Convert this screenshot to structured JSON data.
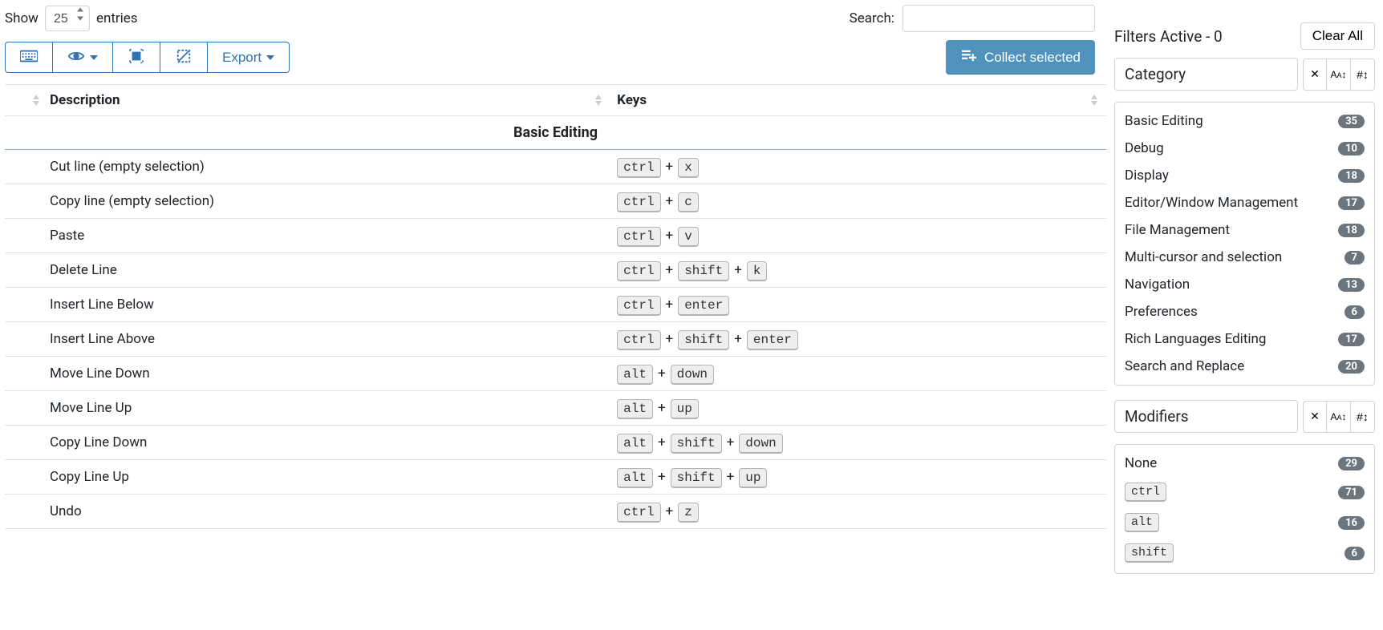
{
  "top": {
    "show_label_pre": "Show",
    "show_value": "25",
    "show_label_post": "entries",
    "search_label": "Search:",
    "search_value": ""
  },
  "toolbar": {
    "export_label": "Export",
    "collect_label": "Collect selected"
  },
  "table": {
    "col_description": "Description",
    "col_keys": "Keys",
    "group_label": "Basic Editing",
    "rows": [
      {
        "desc": "Cut line (empty selection)",
        "keys": [
          "ctrl",
          "x"
        ]
      },
      {
        "desc": "Copy line (empty selection)",
        "keys": [
          "ctrl",
          "c"
        ]
      },
      {
        "desc": "Paste",
        "keys": [
          "ctrl",
          "v"
        ]
      },
      {
        "desc": "Delete Line",
        "keys": [
          "ctrl",
          "shift",
          "k"
        ]
      },
      {
        "desc": "Insert Line Below",
        "keys": [
          "ctrl",
          "enter"
        ]
      },
      {
        "desc": "Insert Line Above",
        "keys": [
          "ctrl",
          "shift",
          "enter"
        ]
      },
      {
        "desc": "Move Line Down",
        "keys": [
          "alt",
          "down"
        ]
      },
      {
        "desc": "Move Line Up",
        "keys": [
          "alt",
          "up"
        ]
      },
      {
        "desc": "Copy Line Down",
        "keys": [
          "alt",
          "shift",
          "down"
        ]
      },
      {
        "desc": "Copy Line Up",
        "keys": [
          "alt",
          "shift",
          "up"
        ]
      },
      {
        "desc": "Undo",
        "keys": [
          "ctrl",
          "z"
        ]
      }
    ]
  },
  "sidebar": {
    "filters_label": "Filters Active - 0",
    "clear_label": "Clear All",
    "category_title": "Category",
    "modifiers_title": "Modifiers",
    "categories": [
      {
        "name": "Basic Editing",
        "count": "35"
      },
      {
        "name": "Debug",
        "count": "10"
      },
      {
        "name": "Display",
        "count": "18"
      },
      {
        "name": "Editor/Window Management",
        "count": "17"
      },
      {
        "name": "File Management",
        "count": "18"
      },
      {
        "name": "Multi-cursor and selection",
        "count": "7"
      },
      {
        "name": "Navigation",
        "count": "13"
      },
      {
        "name": "Preferences",
        "count": "6"
      },
      {
        "name": "Rich Languages Editing",
        "count": "17"
      },
      {
        "name": "Search and Replace",
        "count": "20"
      }
    ],
    "modifiers": [
      {
        "label": "None",
        "count": "29",
        "kbd": false
      },
      {
        "label": "ctrl",
        "count": "71",
        "kbd": true
      },
      {
        "label": "alt",
        "count": "16",
        "kbd": true
      },
      {
        "label": "shift",
        "count": "6",
        "kbd": true
      }
    ]
  }
}
